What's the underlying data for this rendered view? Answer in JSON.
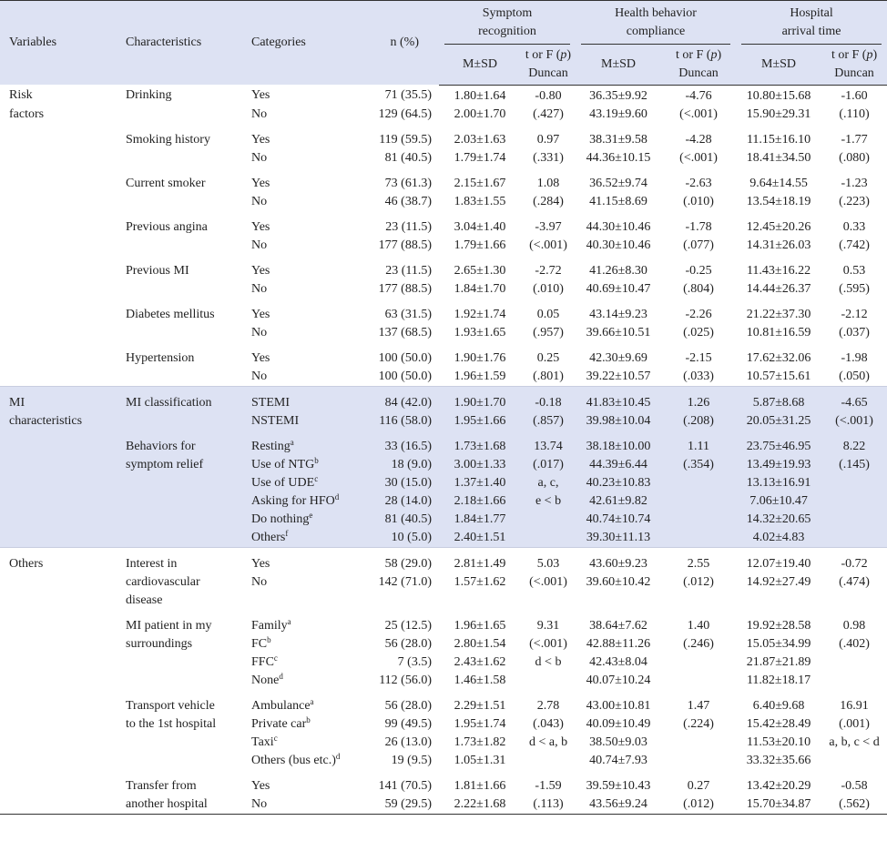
{
  "header": {
    "variables": "Variables",
    "characteristics": "Characteristics",
    "categories": "Categories",
    "n": "n (%)",
    "groups": [
      {
        "l1": "Symptom",
        "l2": "recognition"
      },
      {
        "l1": "Health behavior",
        "l2": "compliance"
      },
      {
        "l1": "Hospital",
        "l2": "arrival time"
      }
    ],
    "msd": "M±SD",
    "tf1": "t or F (p)",
    "tf2": "Duncan"
  },
  "rows": [
    {
      "var": "Risk",
      "chr": "Drinking",
      "cat": "Yes",
      "n": "71 (35.5)",
      "a": "1.80±1.64",
      "at": "-0.80",
      "b": "36.35±9.92",
      "bt": "-4.76",
      "c": "10.80±15.68",
      "ct": "-1.60"
    },
    {
      "var": "factors",
      "chr": "",
      "cat": "No",
      "n": "129 (64.5)",
      "a": "2.00±1.70",
      "at": "(.427)",
      "b": "43.19±9.60",
      "bt": "(<.001)",
      "c": "15.90±29.31",
      "ct": "(.110)"
    },
    {
      "var": "",
      "chr": "Smoking history",
      "cat": "Yes",
      "n": "119 (59.5)",
      "a": "2.03±1.63",
      "at": "0.97",
      "b": "38.31±9.58",
      "bt": "-4.28",
      "c": "11.15±16.10",
      "ct": "-1.77"
    },
    {
      "var": "",
      "chr": "",
      "cat": "No",
      "n": "81 (40.5)",
      "a": "1.79±1.74",
      "at": "(.331)",
      "b": "44.36±10.15",
      "bt": "(<.001)",
      "c": "18.41±34.50",
      "ct": "(.080)"
    },
    {
      "var": "",
      "chr": "Current smoker",
      "cat": "Yes",
      "n": "73 (61.3)",
      "a": "2.15±1.67",
      "at": "1.08",
      "b": "36.52±9.74",
      "bt": "-2.63",
      "c": "9.64±14.55",
      "ct": "-1.23"
    },
    {
      "var": "",
      "chr": "",
      "cat": "No",
      "n": "46 (38.7)",
      "a": "1.83±1.55",
      "at": "(.284)",
      "b": "41.15±8.69",
      "bt": "(.010)",
      "c": "13.54±18.19",
      "ct": "(.223)"
    },
    {
      "var": "",
      "chr": "Previous angina",
      "cat": "Yes",
      "n": "23 (11.5)",
      "a": "3.04±1.40",
      "at": "-3.97",
      "b": "44.30±10.46",
      "bt": "-1.78",
      "c": "12.45±20.26",
      "ct": "0.33"
    },
    {
      "var": "",
      "chr": "",
      "cat": "No",
      "n": "177 (88.5)",
      "a": "1.79±1.66",
      "at": "(<.001)",
      "b": "40.30±10.46",
      "bt": "(.077)",
      "c": "14.31±26.03",
      "ct": "(.742)"
    },
    {
      "var": "",
      "chr": "Previous MI",
      "cat": "Yes",
      "n": "23 (11.5)",
      "a": "2.65±1.30",
      "at": "-2.72",
      "b": "41.26±8.30",
      "bt": "-0.25",
      "c": "11.43±16.22",
      "ct": "0.53"
    },
    {
      "var": "",
      "chr": "",
      "cat": "No",
      "n": "177 (88.5)",
      "a": "1.84±1.70",
      "at": "(.010)",
      "b": "40.69±10.47",
      "bt": "(.804)",
      "c": "14.44±26.37",
      "ct": "(.595)"
    },
    {
      "var": "",
      "chr": "Diabetes mellitus",
      "cat": "Yes",
      "n": "63 (31.5)",
      "a": "1.92±1.74",
      "at": "0.05",
      "b": "43.14±9.23",
      "bt": "-2.26",
      "c": "21.22±37.30",
      "ct": "-2.12"
    },
    {
      "var": "",
      "chr": "",
      "cat": "No",
      "n": "137 (68.5)",
      "a": "1.93±1.65",
      "at": "(.957)",
      "b": "39.66±10.51",
      "bt": "(.025)",
      "c": "10.81±16.59",
      "ct": "(.037)"
    },
    {
      "var": "",
      "chr": "Hypertension",
      "cat": "Yes",
      "n": "100 (50.0)",
      "a": "1.90±1.76",
      "at": "0.25",
      "b": "42.30±9.69",
      "bt": "-2.15",
      "c": "17.62±32.06",
      "ct": "-1.98"
    },
    {
      "var": "",
      "chr": "",
      "cat": "No",
      "n": "100 (50.0)",
      "a": "1.96±1.59",
      "at": "(.801)",
      "b": "39.22±10.57",
      "bt": "(.033)",
      "c": "10.57±15.61",
      "ct": "(.050)"
    },
    {
      "var": "MI",
      "chr": "MI classification",
      "cat": "STEMI",
      "n": "84 (42.0)",
      "a": "1.90±1.70",
      "at": "-0.18",
      "b": "41.83±10.45",
      "bt": "1.26",
      "c": "5.87±8.68",
      "ct": "-4.65"
    },
    {
      "var": "characteristics",
      "chr": "",
      "cat": "NSTEMI",
      "n": "116 (58.0)",
      "a": "1.95±1.66",
      "at": "(.857)",
      "b": "39.98±10.04",
      "bt": "(.208)",
      "c": "20.05±31.25",
      "ct": "(<.001)"
    },
    {
      "var": "",
      "chr": "Behaviors for",
      "cat": "Resting",
      "sup": "a",
      "n": "33 (16.5)",
      "a": "1.73±1.68",
      "at": "13.74",
      "b": "38.18±10.00",
      "bt": "1.11",
      "c": "23.75±46.95",
      "ct": "8.22"
    },
    {
      "var": "",
      "chr": "symptom relief",
      "cat": "Use of NTG",
      "sup": "b",
      "n": "18 (9.0)",
      "a": "3.00±1.33",
      "at": "(.017)",
      "b": "44.39±6.44",
      "bt": "(.354)",
      "c": "13.49±19.93",
      "ct": "(.145)"
    },
    {
      "var": "",
      "chr": "",
      "cat": "Use of UDE",
      "sup": "c",
      "n": "30 (15.0)",
      "a": "1.37±1.40",
      "at": "a, c,",
      "b": "40.23±10.83",
      "bt": "",
      "c": "13.13±16.91",
      "ct": ""
    },
    {
      "var": "",
      "chr": "",
      "cat": "Asking for HFO",
      "sup": "d",
      "n": "28 (14.0)",
      "a": "2.18±1.66",
      "at": "e < b",
      "b": "42.61±9.82",
      "bt": "",
      "c": "7.06±10.47",
      "ct": ""
    },
    {
      "var": "",
      "chr": "",
      "cat": "Do nothing",
      "sup": "e",
      "n": "81 (40.5)",
      "a": "1.84±1.77",
      "at": "",
      "b": "40.74±10.74",
      "bt": "",
      "c": "14.32±20.65",
      "ct": ""
    },
    {
      "var": "",
      "chr": "",
      "cat": "Others",
      "sup": "f",
      "n": "10 (5.0)",
      "a": "2.40±1.51",
      "at": "",
      "b": "39.30±11.13",
      "bt": "",
      "c": "4.02±4.83",
      "ct": ""
    },
    {
      "var": "Others",
      "chr": "Interest in",
      "cat": "Yes",
      "n": "58 (29.0)",
      "a": "2.81±1.49",
      "at": "5.03",
      "b": "43.60±9.23",
      "bt": "2.55",
      "c": "12.07±19.40",
      "ct": "-0.72"
    },
    {
      "var": "",
      "chr": "cardiovascular",
      "cat": "No",
      "n": "142 (71.0)",
      "a": "1.57±1.62",
      "at": "(<.001)",
      "b": "39.60±10.42",
      "bt": "(.012)",
      "c": "14.92±27.49",
      "ct": "(.474)"
    },
    {
      "var": "",
      "chr": "disease",
      "cat": "",
      "n": "",
      "a": "",
      "at": "",
      "b": "",
      "bt": "",
      "c": "",
      "ct": ""
    },
    {
      "var": "",
      "chr": "MI patient in my",
      "cat": "Family",
      "sup": "a",
      "n": "25 (12.5)",
      "a": "1.96±1.65",
      "at": "9.31",
      "b": "38.64±7.62",
      "bt": "1.40",
      "c": "19.92±28.58",
      "ct": "0.98"
    },
    {
      "var": "",
      "chr": "surroundings",
      "cat": "FC",
      "sup": "b",
      "n": "56 (28.0)",
      "a": "2.80±1.54",
      "at": "(<.001)",
      "b": "42.88±11.26",
      "bt": "(.246)",
      "c": "15.05±34.99",
      "ct": "(.402)"
    },
    {
      "var": "",
      "chr": "",
      "cat": "FFC",
      "sup": "c",
      "n": "7 (3.5)",
      "a": "2.43±1.62",
      "at": "d < b",
      "b": "42.43±8.04",
      "bt": "",
      "c": "21.87±21.89",
      "ct": ""
    },
    {
      "var": "",
      "chr": "",
      "cat": "None",
      "sup": "d",
      "n": "112 (56.0)",
      "a": "1.46±1.58",
      "at": "",
      "b": "40.07±10.24",
      "bt": "",
      "c": "11.82±18.17",
      "ct": ""
    },
    {
      "var": "",
      "chr": "Transport vehicle",
      "cat": "Ambulance",
      "sup": "a",
      "n": "56 (28.0)",
      "a": "2.29±1.51",
      "at": "2.78",
      "b": "43.00±10.81",
      "bt": "1.47",
      "c": "6.40±9.68",
      "ct": "16.91"
    },
    {
      "var": "",
      "chr": "to the 1st hospital",
      "cat": "Private car",
      "sup": "b",
      "n": "99 (49.5)",
      "a": "1.95±1.74",
      "at": "(.043)",
      "b": "40.09±10.49",
      "bt": "(.224)",
      "c": "15.42±28.49",
      "ct": "(.001)"
    },
    {
      "var": "",
      "chr": "",
      "cat": "Taxi",
      "sup": "c",
      "n": "26 (13.0)",
      "a": "1.73±1.82",
      "at": "d < a, b",
      "b": "38.50±9.03",
      "bt": "",
      "c": "11.53±20.10",
      "ct": "a, b, c < d"
    },
    {
      "var": "",
      "chr": "",
      "cat": "Others (bus etc.)",
      "sup": "d",
      "n": "19 (9.5)",
      "a": "1.05±1.31",
      "at": "",
      "b": "40.74±7.93",
      "bt": "",
      "c": "33.32±35.66",
      "ct": ""
    },
    {
      "var": "",
      "chr": "Transfer from",
      "cat": "Yes",
      "n": "141 (70.5)",
      "a": "1.81±1.66",
      "at": "-1.59",
      "b": "39.59±10.43",
      "bt": "0.27",
      "c": "13.42±20.29",
      "ct": "-0.58"
    },
    {
      "var": "",
      "chr": "another hospital",
      "cat": "No",
      "n": "59 (29.5)",
      "a": "2.22±1.68",
      "at": "(.113)",
      "b": "43.56±9.24",
      "bt": "(.012)",
      "c": "15.70±34.87",
      "ct": "(.562)"
    }
  ]
}
